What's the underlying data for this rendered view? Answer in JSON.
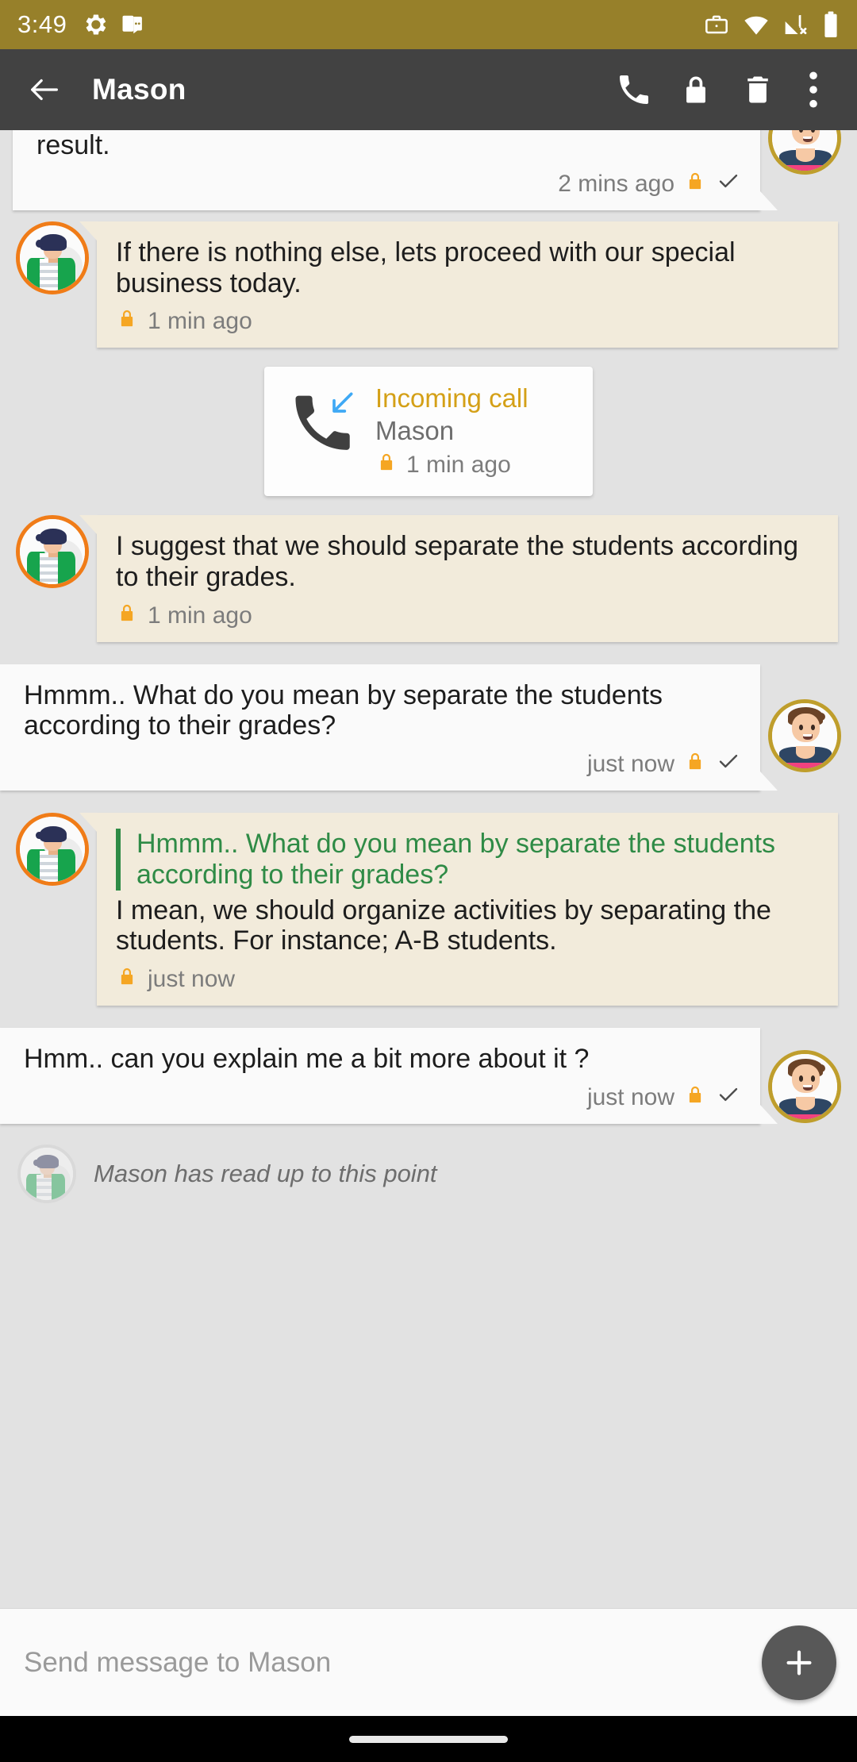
{
  "status_bar": {
    "time": "3:49",
    "left_icons": [
      "gear-icon",
      "work-message-icon"
    ],
    "right_icons": [
      "work-briefcase-icon",
      "wifi-icon",
      "cellular-off-icon",
      "battery-icon"
    ],
    "background_color": "#97802a"
  },
  "app_bar": {
    "back_label": "back-arrow",
    "title": "Mason",
    "actions": [
      "call-icon",
      "lock-icon",
      "delete-icon",
      "overflow-menu-icon"
    ],
    "background_color": "#424242"
  },
  "conversation": {
    "messages": [
      {
        "id": "msg-0",
        "direction": "outgoing",
        "text": "result.",
        "truncated_top": true,
        "time": "2 mins ago",
        "encrypted": true,
        "delivered": true
      },
      {
        "id": "msg-1",
        "direction": "incoming",
        "text": "If there is nothing else, lets proceed with our special business today.",
        "time": "1 min ago",
        "encrypted": true
      },
      {
        "id": "call-1",
        "type": "call",
        "call_title": "Incoming call",
        "call_name": "Mason",
        "time": "1 min ago",
        "encrypted": true
      },
      {
        "id": "msg-2",
        "direction": "incoming",
        "text": "I suggest that we should separate the students according to their grades.",
        "time": "1 min ago",
        "encrypted": true
      },
      {
        "id": "msg-3",
        "direction": "outgoing",
        "text": "Hmmm.. What do you mean by separate the students according to their grades?",
        "time": "just now",
        "encrypted": true,
        "delivered": true
      },
      {
        "id": "msg-4",
        "direction": "incoming",
        "quote": "Hmmm.. What do you mean by separate the students according to their grades?",
        "text": "I mean, we should organize activities by separating the students. For instance; A-B students.",
        "time": "just now",
        "encrypted": true
      },
      {
        "id": "msg-5",
        "direction": "outgoing",
        "text": "Hmm.. can you explain me a bit more about it ?",
        "time": "just now",
        "encrypted": true,
        "delivered": true
      }
    ],
    "read_receipt": "Mason has read up to this point",
    "background_color": "#e2e2e2",
    "incoming_bubble_color": "#f2ebdb",
    "outgoing_bubble_color": "#fafafa",
    "quote_accent_color": "#2f8b46",
    "lock_color": "#f5a623",
    "incoming_avatar_ring": "#f07c18",
    "outgoing_avatar_ring": "#bf9e2c"
  },
  "compose": {
    "placeholder": "Send message to Mason",
    "attach_label": "+"
  }
}
